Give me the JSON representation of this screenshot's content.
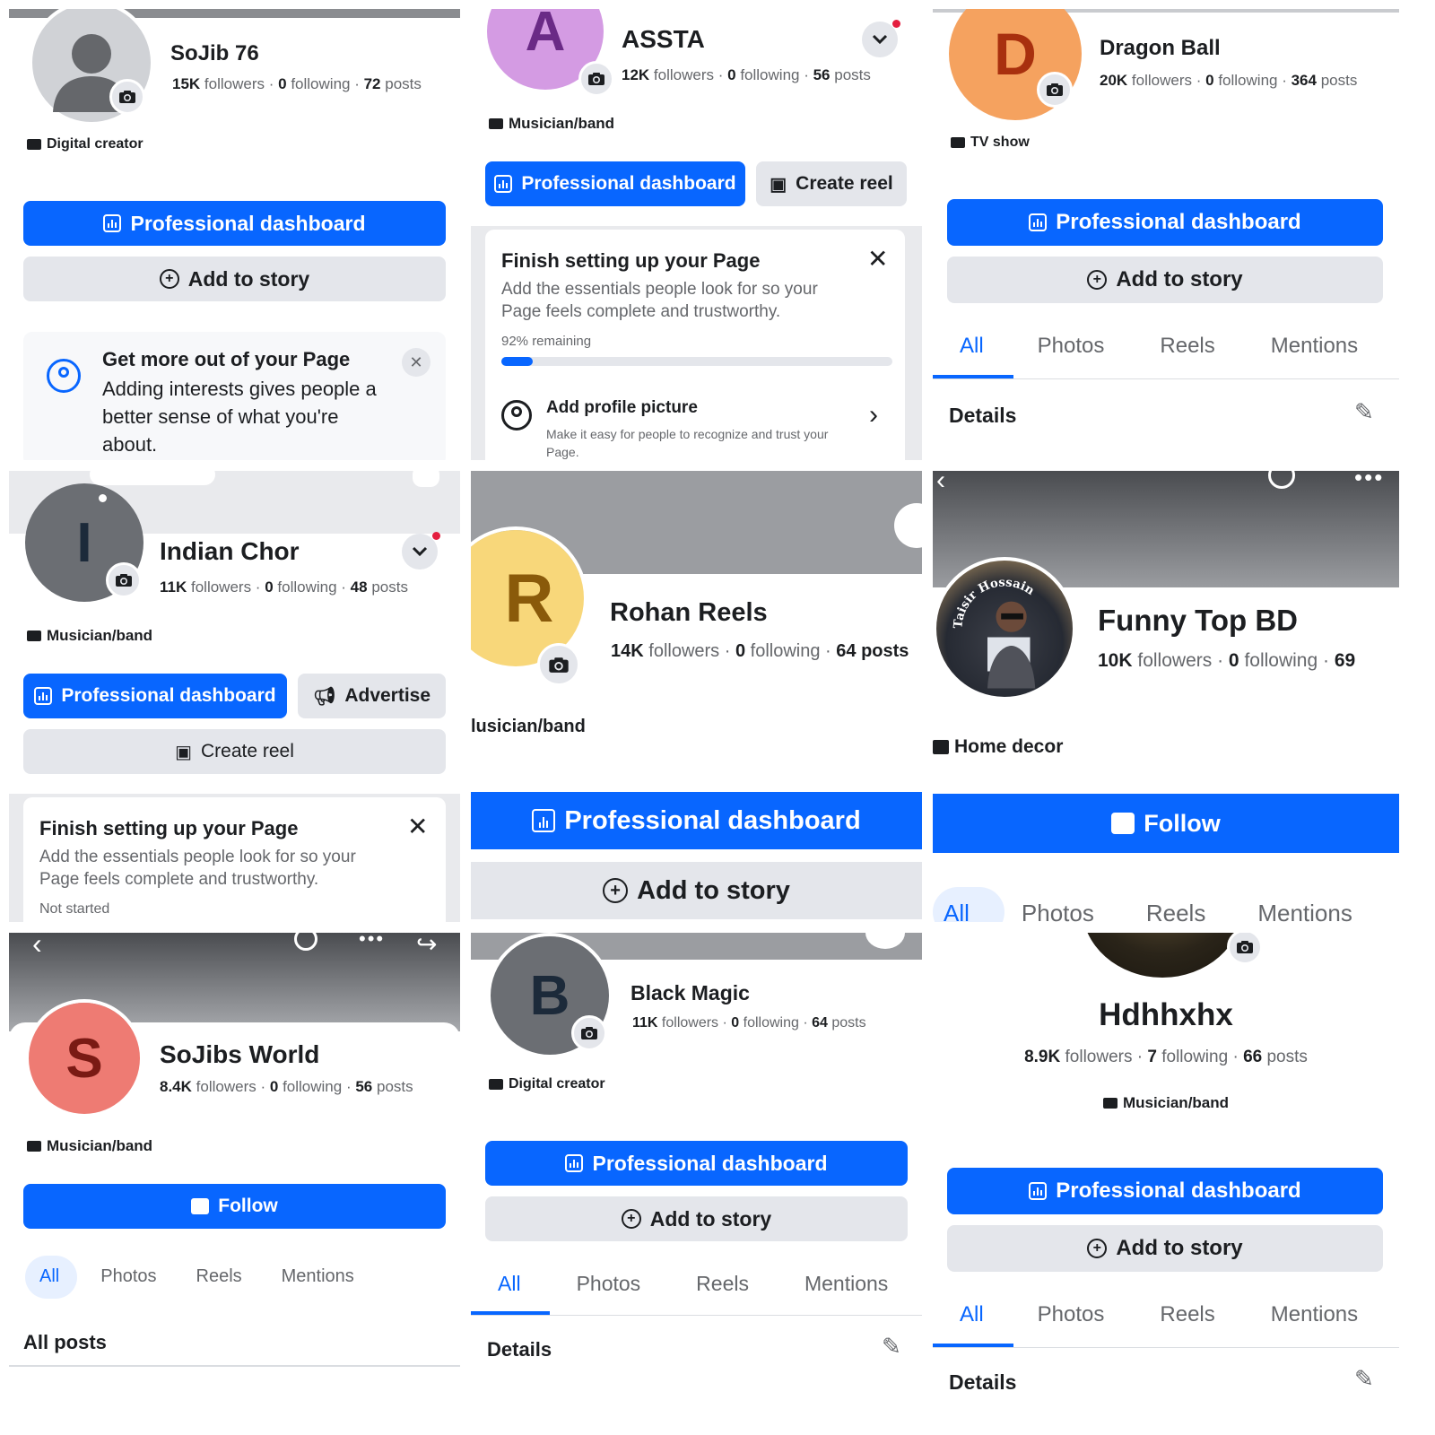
{
  "colors": {
    "accent": "#0866ff",
    "secondary_bg": "#e4e6eb",
    "muted_text": "#65676b"
  },
  "common": {
    "pro_dashboard": "Professional dashboard",
    "add_to_story": "Add to story",
    "create_reel": "Create reel",
    "advertise": "Advertise",
    "follow": "Follow",
    "details": "Details",
    "all_posts": "All posts",
    "tabs": [
      "All",
      "Photos",
      "Reels",
      "Mentions"
    ],
    "finish_title": "Finish setting up your Page",
    "finish_desc": "Add the essentials people look for so your Page feels complete and trustworthy."
  },
  "profiles": [
    {
      "name": "SoJib 76",
      "followers": "15K",
      "following": "0",
      "posts": "72",
      "category": "Digital creator",
      "card": {
        "title": "Get more out of your Page",
        "desc": "Adding interests gives people a better sense of what you're about."
      }
    },
    {
      "name": "ASSTA",
      "initial": "A",
      "avatar_color": "#d49be3",
      "initial_color": "#6a2a86",
      "followers": "12K",
      "following": "0",
      "posts": "56",
      "category": "Musician/band",
      "progress_label": "92% remaining",
      "progress_done": 0.08,
      "item": {
        "title": "Add profile picture",
        "desc": "Make it easy for people to recognize and trust your Page."
      }
    },
    {
      "name": "Dragon Ball",
      "initial": "D",
      "avatar_color": "#f5a25f",
      "initial_color": "#a8300e",
      "followers": "20K",
      "following": "0",
      "posts": "364",
      "category": "TV show"
    },
    {
      "name": "Indian Chor",
      "initial": "I",
      "avatar_color": "#6b6e73",
      "initial_color": "#1c2a3a",
      "followers": "11K",
      "following": "0",
      "posts": "48",
      "category": "Musician/band",
      "progress_label": "Not started"
    },
    {
      "name": "Rohan Reels",
      "initial": "R",
      "avatar_color": "#f8d77a",
      "initial_color": "#8a5a0a",
      "followers": "14K",
      "following": "0",
      "posts_partial": "64 posts",
      "category": "lusician/band"
    },
    {
      "name": "Funny Top BD",
      "followers": "10K",
      "following": "0",
      "posts_partial": "69",
      "category": "Home decor",
      "avatar_text": "Taisir Hossain"
    },
    {
      "name": "SoJibs World",
      "initial": "S",
      "avatar_color": "#ee7b73",
      "initial_color": "#7a1a14",
      "followers": "8.4K",
      "following": "0",
      "posts": "56",
      "category": "Musician/band"
    },
    {
      "name": "Black Magic",
      "initial": "B",
      "avatar_color": "#6b6e73",
      "initial_color": "#1c2a3a",
      "followers": "11K",
      "following": "0",
      "posts": "64",
      "category": "Digital creator"
    },
    {
      "name": "Hdhhxhx",
      "followers": "8.9K",
      "following": "7",
      "posts": "66",
      "category": "Musician/band"
    }
  ],
  "labels": {
    "followers": "followers",
    "following": "following",
    "posts": "posts"
  }
}
